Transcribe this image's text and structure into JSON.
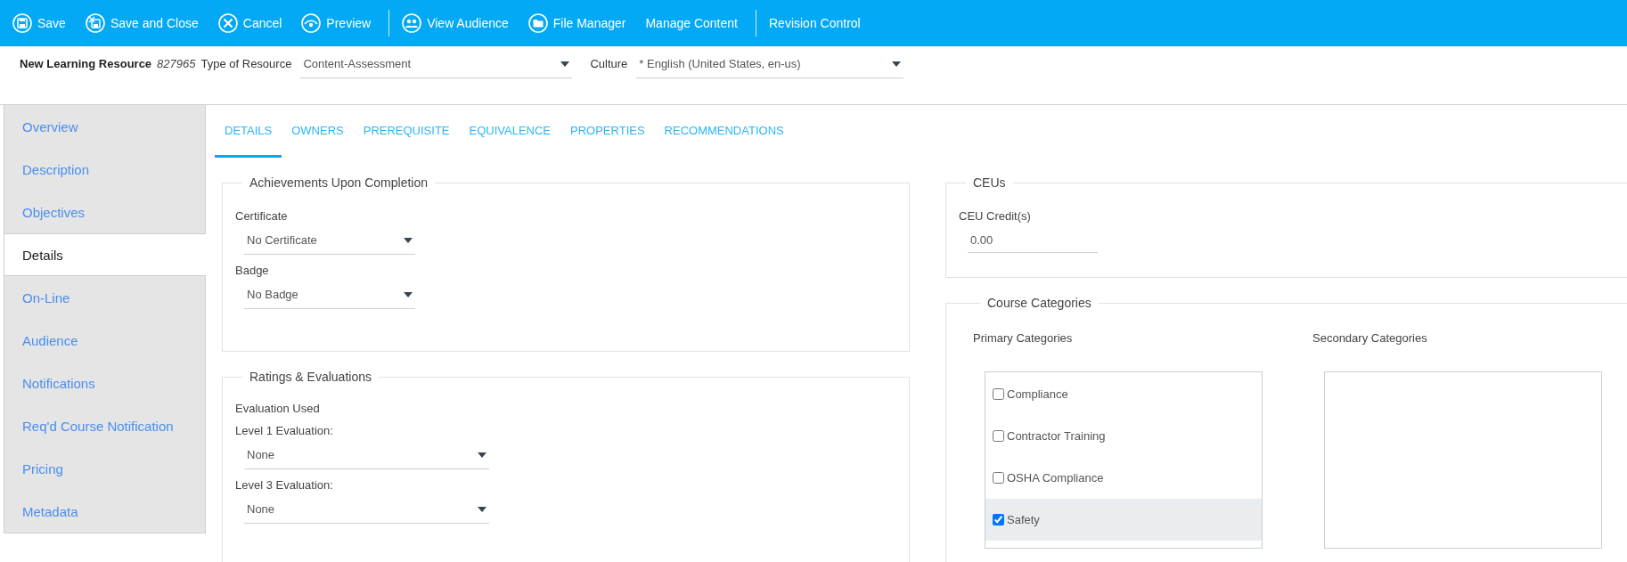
{
  "toolbar": {
    "groups": [
      [
        {
          "label": "Save"
        },
        {
          "label": "Save and Close"
        },
        {
          "label": "Cancel"
        },
        {
          "label": "Preview"
        }
      ],
      [
        {
          "label": "View Audience"
        },
        {
          "label": "File Manager"
        },
        {
          "label": "Manage Content"
        }
      ],
      [
        {
          "label": "Revision Control"
        }
      ]
    ]
  },
  "header": {
    "title": "New Learning Resource",
    "resource_id": "827965",
    "fields": [
      {
        "label": "Type of Resource",
        "value": "Content-Assessment"
      },
      {
        "label": "Culture",
        "value": "* English (United States, en-us)"
      }
    ]
  },
  "sidebar": {
    "items": [
      {
        "label": "Overview",
        "selected": false
      },
      {
        "label": "Description",
        "selected": false
      },
      {
        "label": "Objectives",
        "selected": false
      },
      {
        "label": "Details",
        "selected": true
      },
      {
        "label": "On-Line",
        "selected": false
      },
      {
        "label": "Audience",
        "selected": false
      },
      {
        "label": "Notifications",
        "selected": false
      },
      {
        "label": "Req'd Course Notification",
        "selected": false
      },
      {
        "label": "Pricing",
        "selected": false
      },
      {
        "label": "Metadata",
        "selected": false
      }
    ]
  },
  "tabs": [
    {
      "label": "DETAILS",
      "selected": true
    },
    {
      "label": "OWNERS",
      "selected": false
    },
    {
      "label": "PREREQUISITE",
      "selected": false
    },
    {
      "label": "EQUIVALENCE",
      "selected": false
    },
    {
      "label": "PROPERTIES",
      "selected": false
    },
    {
      "label": "RECOMMENDATIONS",
      "selected": false
    }
  ],
  "achievements": {
    "title": "Achievements Upon Completion",
    "fields": [
      {
        "kind": "select",
        "label": "Certificate",
        "value": "No Certificate"
      },
      {
        "kind": "select",
        "label": "Badge",
        "value": "No Badge"
      }
    ]
  },
  "ratings": {
    "title": "Ratings & Evaluations",
    "fields": [
      {
        "kind": "heading",
        "label": "Evaluation Used"
      },
      {
        "kind": "select",
        "label": "Level 1 Evaluation:",
        "value": "None"
      },
      {
        "kind": "select",
        "label": "Level 3 Evaluation:",
        "value": "None"
      }
    ]
  },
  "ceus": {
    "title": "CEUs",
    "fields": [
      {
        "kind": "input",
        "label": "CEU Credit(s)",
        "value": "0.00"
      }
    ]
  },
  "course_categories": {
    "title": "Course Categories",
    "primary": {
      "label": "Primary Categories",
      "items": [
        {
          "label": "Compliance",
          "checked": false,
          "selected": false
        },
        {
          "label": "Contractor Training",
          "checked": false,
          "selected": false
        },
        {
          "label": "OSHA Compliance",
          "checked": false,
          "selected": false
        },
        {
          "label": "Safety",
          "checked": true,
          "selected": true
        }
      ]
    },
    "secondary": {
      "label": "Secondary Categories"
    }
  }
}
